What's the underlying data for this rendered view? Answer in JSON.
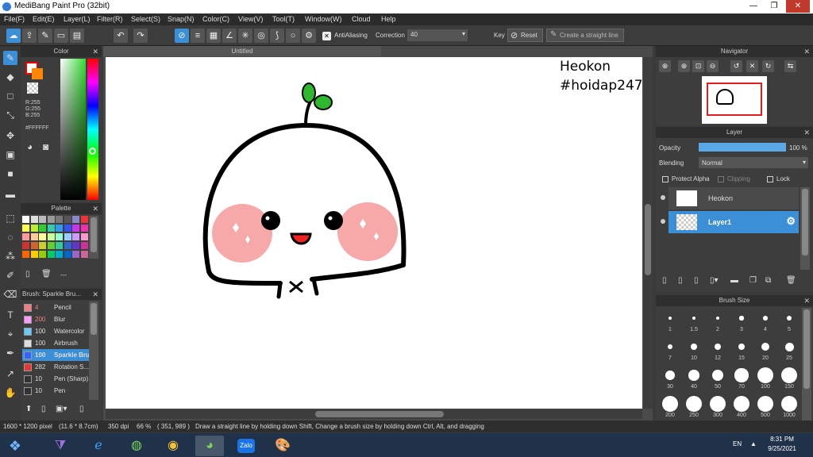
{
  "window": {
    "title": "MediBang Paint Pro (32bit)"
  },
  "menu": [
    "File(F)",
    "Edit(E)",
    "Layer(L)",
    "Filter(R)",
    "Select(S)",
    "Snap(N)",
    "Color(C)",
    "View(V)",
    "Tool(T)",
    "Window(W)",
    "Cloud",
    "Help"
  ],
  "toolbar": {
    "antialiasing_label": "AntiAliasing",
    "correction_label": "Correction",
    "correction_value": "40",
    "key_label": "Key",
    "reset_label": "Reset",
    "straight_line_label": "Create a straight line"
  },
  "color_panel": {
    "title": "Color",
    "r": "R:255",
    "g": "G:255",
    "b": "B:255",
    "hex": "#FFFFFF"
  },
  "palette_panel": {
    "title": "Palette",
    "footer": "---",
    "colors": [
      "#ffffff",
      "#dddddd",
      "#bbbbbb",
      "#999999",
      "#777777",
      "#555555",
      "#8888cc",
      "#ee3333",
      "#ffff55",
      "#bbee33",
      "#33cc33",
      "#33ccaa",
      "#3399ee",
      "#3355ee",
      "#cc33ee",
      "#ee33aa",
      "#ff9999",
      "#ffcc99",
      "#ffff99",
      "#ccff99",
      "#99ffcc",
      "#99ccff",
      "#cc99ff",
      "#ff99cc",
      "#cc3333",
      "#cc6633",
      "#cccc33",
      "#66cc33",
      "#33cc99",
      "#3366cc",
      "#6633cc",
      "#cc3399",
      "#ff6600",
      "#ffcc00",
      "#99cc00",
      "#00cc66",
      "#00aacc",
      "#0066cc",
      "#9966cc",
      "#cc6699"
    ]
  },
  "brush_panel": {
    "title": "Brush: Sparkle Bru...",
    "items": [
      {
        "color": "#f08080",
        "size": "4",
        "label": "Pencil"
      },
      {
        "color": "#ff99ff",
        "size": "200",
        "label": "Blur"
      },
      {
        "color": "#66ccff",
        "size": "100",
        "label": "Watercolor"
      },
      {
        "color": "#dddddd",
        "size": "100",
        "label": "Airbrush"
      },
      {
        "color": "#3366ff",
        "size": "100",
        "label": "Sparkle Brush"
      },
      {
        "color": "#ee3333",
        "size": "282",
        "label": "Rotation S..."
      },
      {
        "color": "#333333",
        "size": "10",
        "label": "Pen (Sharp)"
      },
      {
        "color": "#333333",
        "size": "10",
        "label": "Pen"
      }
    ]
  },
  "document": {
    "tab": "Untitled",
    "text_line1": "Heokon",
    "text_line2": "#hoidap247"
  },
  "navigator": {
    "title": "Navigator"
  },
  "layer_panel": {
    "title": "Layer",
    "opacity_label": "Opacity",
    "opacity_value": "100 %",
    "opacity": 1.0,
    "blending_label": "Blending",
    "blending_value": "Normal",
    "protect_alpha": "Protect Alpha",
    "clipping": "Clipping",
    "lock": "Lock",
    "layers": [
      {
        "name": "Heokon",
        "selected": false
      },
      {
        "name": "Layer1",
        "selected": true
      }
    ]
  },
  "brush_size_panel": {
    "title": "Brush Size",
    "sizes": [
      "1",
      "1.5",
      "2",
      "3",
      "4",
      "5",
      "7",
      "10",
      "12",
      "15",
      "20",
      "25",
      "30",
      "40",
      "50",
      "70",
      "100",
      "150",
      "200",
      "250",
      "300",
      "400",
      "500",
      "1000"
    ]
  },
  "status": {
    "dimensions": "1600 * 1200 pixel",
    "physical": "(11.6 * 8.7cm)",
    "dpi": "350 dpi",
    "zoom": "66 %",
    "coords": "( 351, 989 )",
    "hint": "Draw a straight line by holding down Shift, Change a brush size by holding down Ctrl, Alt, and dragging"
  },
  "taskbar": {
    "lang": "EN",
    "time": "8:31 PM",
    "date": "9/25/2021",
    "zalo_label": "Zalo"
  },
  "colors": {
    "accent": "#3b8fd6",
    "panel_bg": "#3d3d3d",
    "taskbar": "#20324a"
  }
}
